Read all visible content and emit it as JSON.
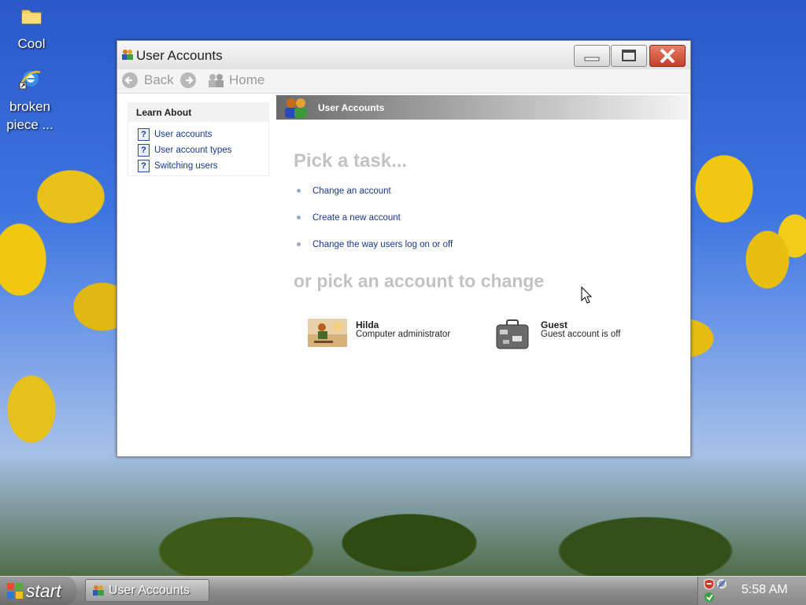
{
  "desktop": {
    "icons": [
      {
        "label": "Cool",
        "icon": "folder-icon"
      },
      {
        "label": "broken piece ...",
        "icon": "internet-explorer-icon"
      }
    ]
  },
  "window": {
    "title": "User Accounts",
    "nav": {
      "back": "Back",
      "home": "Home"
    },
    "learn_about": {
      "heading": "Learn About",
      "links": [
        "User accounts",
        "User account types",
        "Switching users"
      ]
    },
    "header": {
      "title": "User Accounts"
    },
    "pick_task_heading": "Pick a task...",
    "tasks": [
      "Change an account",
      "Create a new account",
      "Change the way users log on or off"
    ],
    "pick_account_heading": "or pick an account to change",
    "accounts": [
      {
        "name": "Hilda",
        "desc": "Computer administrator",
        "icon": "skateboarder-avatar-icon"
      },
      {
        "name": "Guest",
        "desc": "Guest account is off",
        "icon": "suitcase-icon"
      }
    ]
  },
  "taskbar": {
    "start_label": "start",
    "active_task": "User Accounts",
    "clock": "5:58 AM"
  }
}
